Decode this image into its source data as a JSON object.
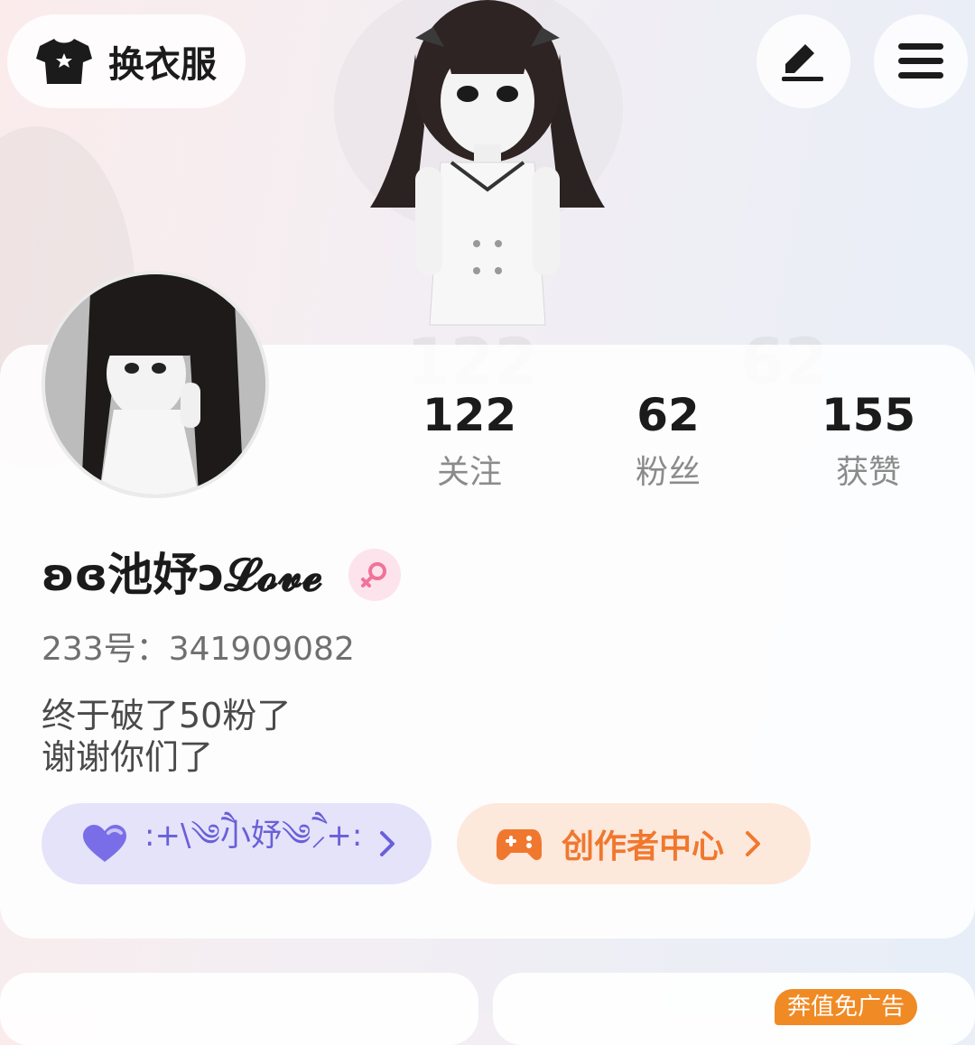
{
  "topbar": {
    "dress_up_label": "换衣服",
    "dress_icon": "tshirt-icon",
    "edit_icon": "pencil-icon",
    "menu_icon": "hamburger-menu-icon"
  },
  "stats": [
    {
      "value": "122",
      "label": "关注"
    },
    {
      "value": "62",
      "label": "粉丝"
    },
    {
      "value": "155",
      "label": "获赞"
    }
  ],
  "profile": {
    "nickname": "ʚɞ池妤ↄ𝓛𝓸𝓿𝓮",
    "gender_icon": "female-icon",
    "user_id": "233号：341909082",
    "bio_lines": [
      "终于破了50粉了",
      "谢谢你们了"
    ]
  },
  "buttons": {
    "heart_label": ":+\\༄ཻ小妤༄ཻ⸝+:",
    "heart_icon": "heart-icon",
    "creator_label": "创作者中心",
    "creator_icon": "gamepad-icon"
  },
  "bottom": {
    "ad_badge": "奔值免广告"
  },
  "colors": {
    "accent_purple": "#6a5fd8",
    "accent_orange": "#f0782e",
    "badge_orange": "#f08a24"
  }
}
